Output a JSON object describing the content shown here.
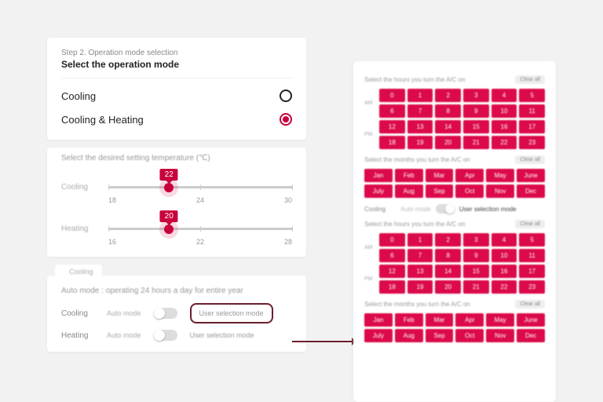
{
  "step": {
    "label": "Step 2.  Operation mode selection",
    "title": "Select the operation mode",
    "options": [
      {
        "label": "Cooling",
        "selected": false
      },
      {
        "label": "Cooling & Heating",
        "selected": true
      }
    ]
  },
  "temp": {
    "header": "Select the desired setting temperature (℃)",
    "cooling": {
      "label": "Cooling",
      "value": "22",
      "min": "18",
      "mid": "24",
      "max": "30",
      "pos_pct": 33
    },
    "heating": {
      "label": "Heating",
      "value": "20",
      "min": "16",
      "mid": "22",
      "max": "28",
      "pos_pct": 33
    }
  },
  "truncated": "Cooling",
  "mode": {
    "header": "Auto mode : operating 24 hours a day for entire year",
    "rows": [
      {
        "label": "Cooling",
        "auto": "Auto mode",
        "user": "User selection mode",
        "highlighted": true
      },
      {
        "label": "Heating",
        "auto": "Auto mode",
        "user": "User selection mode",
        "highlighted": false
      }
    ]
  },
  "right": {
    "hours_label": "Select the hours you turn the A/C on",
    "months_label": "Select the months you turn the A/C on",
    "clear": "Clear all",
    "am": "AM",
    "pm": "PM",
    "hours": [
      "0",
      "1",
      "2",
      "3",
      "4",
      "5",
      "6",
      "7",
      "8",
      "9",
      "10",
      "11",
      "12",
      "13",
      "14",
      "15",
      "16",
      "17",
      "18",
      "19",
      "20",
      "21",
      "22",
      "23"
    ],
    "months": [
      "Jan",
      "Feb",
      "Mar",
      "Apr",
      "May",
      "June",
      "July",
      "Aug",
      "Sep",
      "Oct",
      "Nov",
      "Dec"
    ],
    "cooling_label": "Cooling",
    "auto": "Auto mode",
    "user": "User selection mode"
  }
}
